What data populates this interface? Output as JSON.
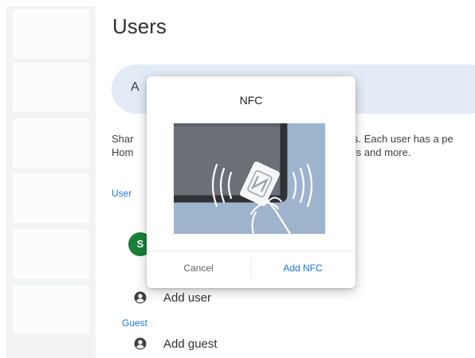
{
  "page": {
    "title": "Users"
  },
  "banner": {
    "text": "A"
  },
  "description": {
    "line1_left": "Shar",
    "line1_right": "ers. Each user has a pe",
    "line2_left": "Hom",
    "line2_right": "ings and more."
  },
  "sections": {
    "users": "User",
    "guest": "Guest"
  },
  "user_avatar": {
    "initial": "S",
    "color": "#188038"
  },
  "actions": {
    "add_user": "Add user",
    "add_guest": "Add guest"
  },
  "dialog": {
    "title": "NFC",
    "cancel_label": "Cancel",
    "confirm_label": "Add NFC",
    "illustration_icon": "nfc-card-tap-icon"
  },
  "colors": {
    "accent": "#1a73e8",
    "banner": "#e3ebf7",
    "sidebar": "#f1f3f4"
  }
}
